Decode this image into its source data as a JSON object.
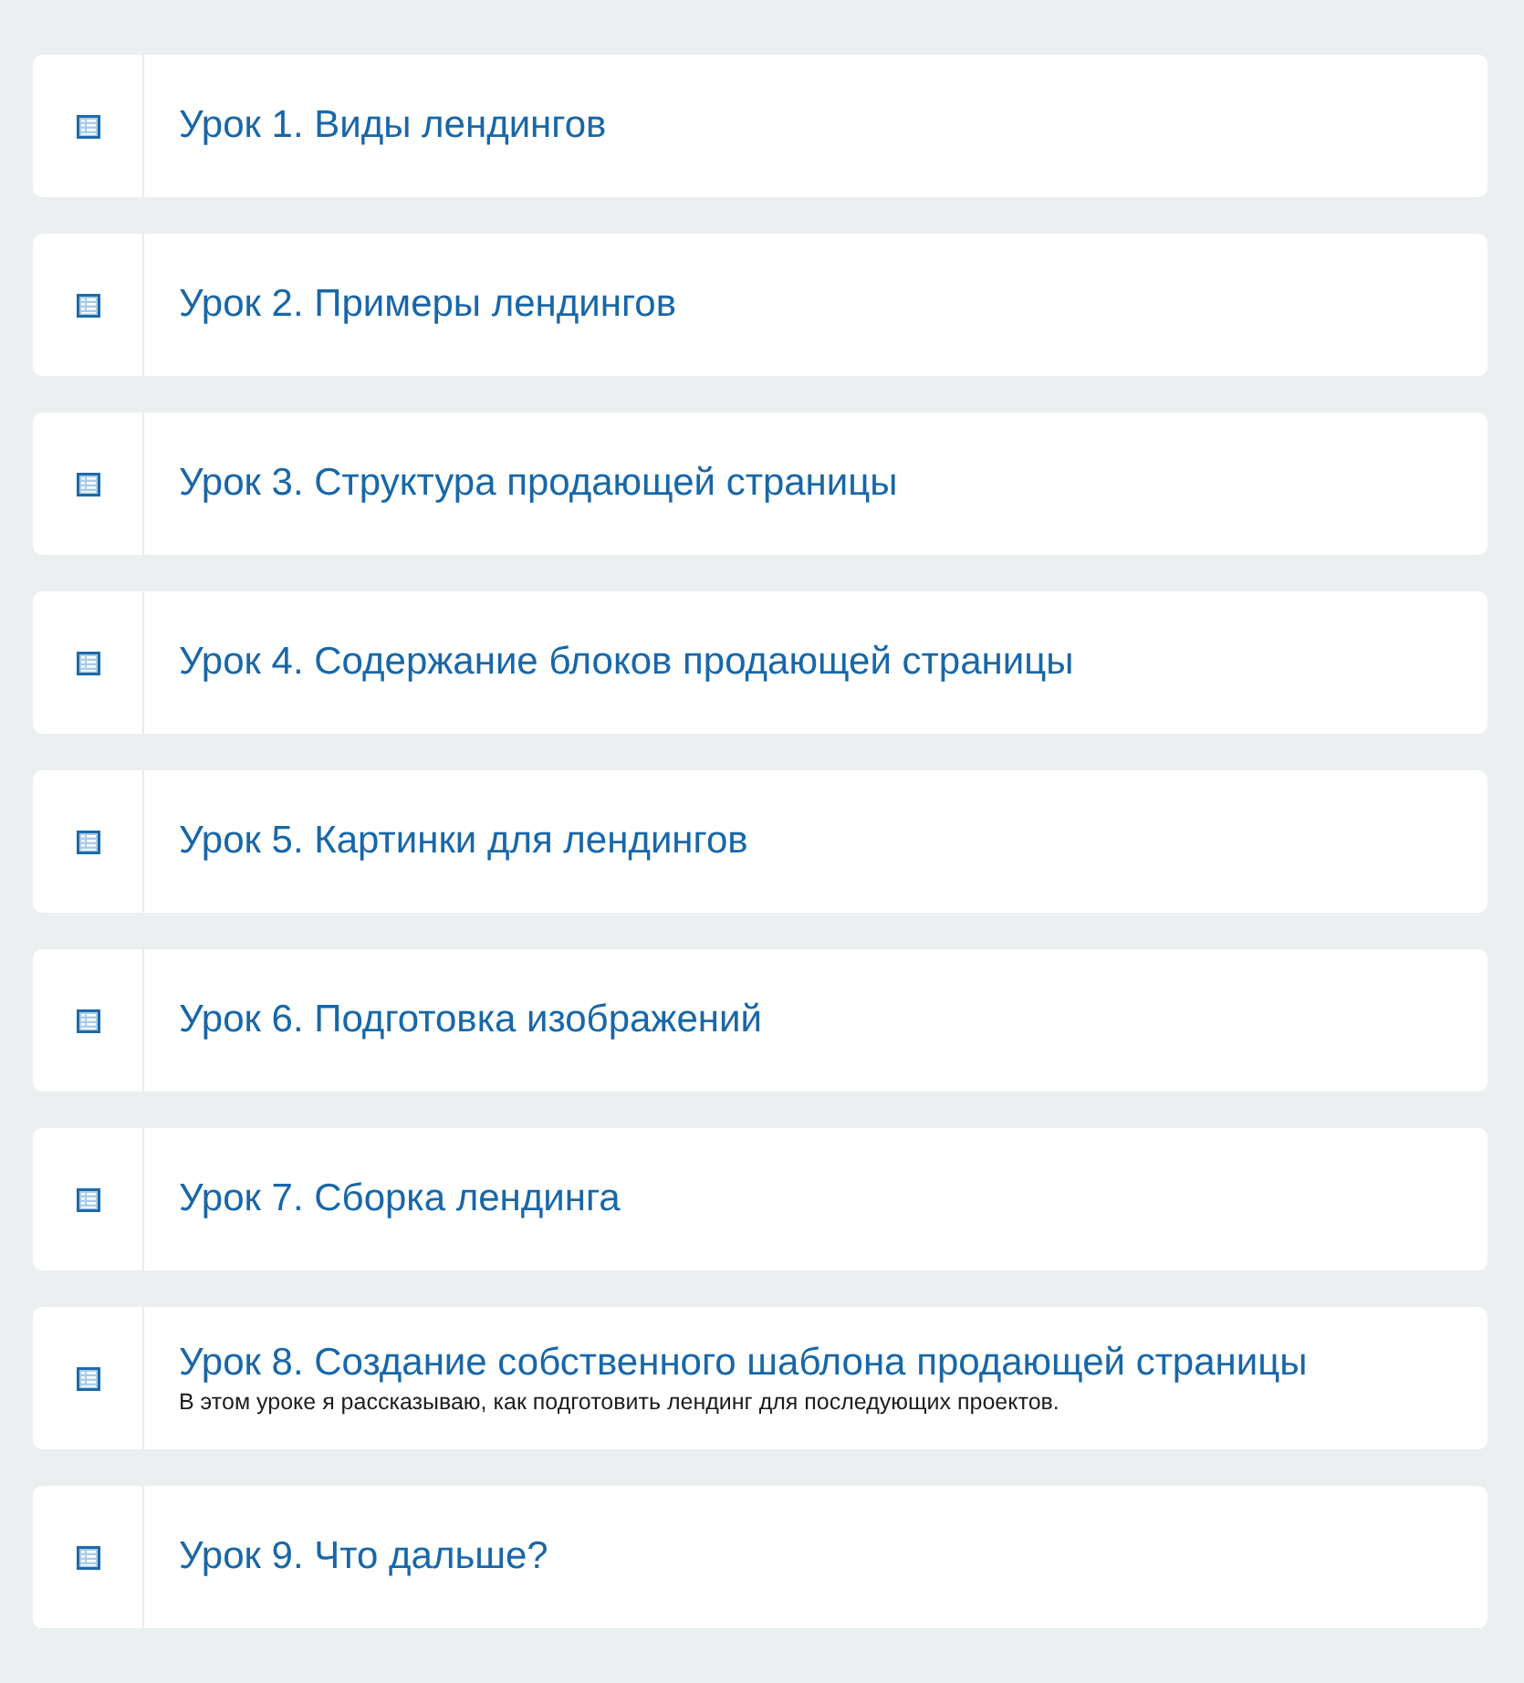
{
  "lessons": [
    {
      "title": "Урок 1. Виды лендингов"
    },
    {
      "title": "Урок 2. Примеры лендингов"
    },
    {
      "title": "Урок 3. Структура продающей страницы"
    },
    {
      "title": "Урок 4. Содержание блоков продающей страницы"
    },
    {
      "title": "Урок 5. Картинки для лендингов"
    },
    {
      "title": "Урок 6. Подготовка изображений"
    },
    {
      "title": "Урок 7. Сборка лендинга"
    },
    {
      "title": "Урок 8. Создание собственного шаблона продающей страницы",
      "description": "В этом уроке я рассказываю, как подготовить лендинг для последующих проектов."
    },
    {
      "title": "Урок 9. Что дальше?"
    }
  ]
}
